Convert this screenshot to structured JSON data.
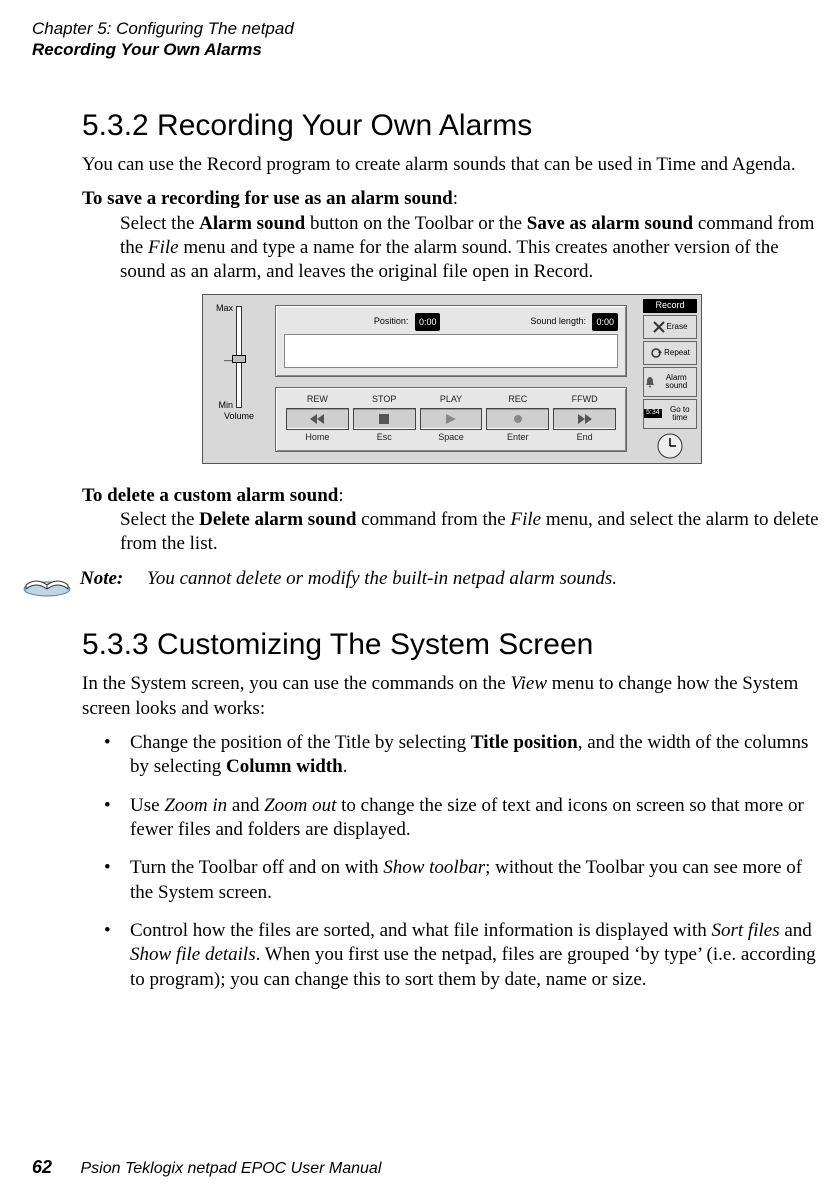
{
  "header": {
    "chapter_line": "Chapter 5:  Configuring The netpad",
    "section_line": "Recording Your Own Alarms"
  },
  "s1": {
    "heading": "5.3.2   Recording Your Own Alarms",
    "intro": "You can use the Record program to create alarm sounds that can be used in Time and Agenda.",
    "save_title": "To save a recording for use as an alarm sound",
    "save_body_1": "Select the ",
    "save_body_alarm_sound": "Alarm sound",
    "save_body_2": " button on the Toolbar or the ",
    "save_body_saveas": "Save as alarm sound",
    "save_body_3": " command from the ",
    "save_body_file": "File",
    "save_body_4": " menu and type a name for the alarm sound. This creates another version of the sound as an alarm, and leaves the original file open in Record.",
    "delete_title": "To delete a custom alarm sound",
    "delete_body_1": "Select the ",
    "delete_body_cmd": "Delete alarm sound",
    "delete_body_2": " command from the ",
    "delete_body_file": "File",
    "delete_body_3": " menu, and select the alarm to delete from the list."
  },
  "note": {
    "label": "Note:",
    "text": "You cannot delete or modify the built-in netpad alarm sounds."
  },
  "s2": {
    "heading": "5.3.3   Customizing The System Screen",
    "intro_1": "In the System screen, you can use the commands on the ",
    "intro_view": "View",
    "intro_2": " menu to change how the System screen looks and works:",
    "bullets": [
      {
        "pre": "Change the position of the Title by selecting ",
        "b1": "Title position",
        "mid": ", and the width of the columns by selecting ",
        "b2": "Column width",
        "post": "."
      },
      {
        "pre": "Use ",
        "i1": "Zoom in",
        "mid1": " and ",
        "i2": "Zoom out",
        "post": " to change the size of text and icons on screen so that more or fewer files and folders are displayed."
      },
      {
        "pre": "Turn the Toolbar off and on with ",
        "i1": "Show toolbar",
        "post": "; without the Toolbar you can see more of the System screen."
      },
      {
        "pre": "Control how the files are sorted, and what file information is displayed with ",
        "i1": "Sort files",
        "mid1": " and ",
        "i2": "Show file details",
        "post": ". When you first use the netpad, files are grouped ‘by type’ (i.e. according to program); you can change this to sort them by date, name or size."
      }
    ]
  },
  "figure": {
    "volume_max": "Max",
    "volume_min": "Min",
    "volume_label": "Volume",
    "position_label": "Position:",
    "position_value": "0:00",
    "length_label": "Sound length:",
    "length_value": "0:00",
    "transport_labels": [
      "REW",
      "STOP",
      "PLAY",
      "REC",
      "FFWD"
    ],
    "transport_keys": [
      "Home",
      "Esc",
      "Space",
      "Enter",
      "End"
    ],
    "toolbar_title": "Record",
    "toolbar_items": [
      "Erase",
      "Repeat",
      "Alarm sound",
      "Go to time"
    ]
  },
  "footer": {
    "page": "62",
    "text": "Psion Teklogix netpad EPOC User Manual"
  }
}
